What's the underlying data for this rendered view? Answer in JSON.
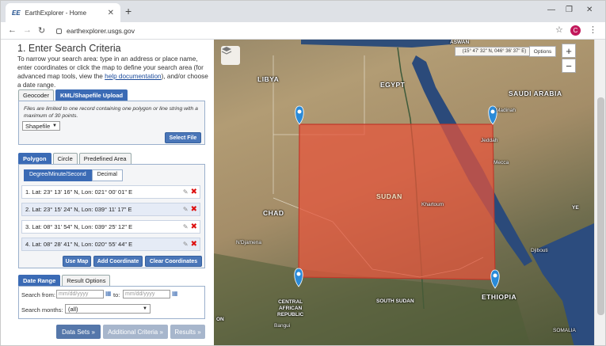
{
  "browser": {
    "tab_title": "EarthExplorer - Home",
    "tab_favicon": "EE",
    "url": "earthexplorer.usgs.gov",
    "avatar_letter": "C",
    "avatar_color": "#c2185b"
  },
  "panel": {
    "heading": "1. Enter Search Criteria",
    "intro_before_link": "To narrow your search area: type in an address or place name, enter coordinates or click the map to define your search area (for advanced map tools, view the ",
    "intro_link": "help documentation",
    "intro_after_link": "), and/or choose a date range.",
    "upload_tabs": [
      {
        "label": "Geocoder",
        "active": false
      },
      {
        "label": "KML/Shapefile Upload",
        "active": true
      }
    ],
    "upload_note": "Files are limited to one record containing one polygon or line string with a maximum of 30 points.",
    "file_type": "Shapefile",
    "select_file_label": "Select File",
    "shape_tabs": [
      {
        "label": "Polygon",
        "active": true
      },
      {
        "label": "Circle",
        "active": false
      },
      {
        "label": "Predefined Area",
        "active": false
      }
    ],
    "format_tabs": [
      {
        "label": "Degree/Minute/Second",
        "active": true
      },
      {
        "label": "Decimal",
        "active": false
      }
    ],
    "coordinates": [
      "1.  Lat: 23° 13' 16\" N, Lon: 021° 00' 01\" E",
      "2.  Lat: 23° 15' 24\" N, Lon: 039° 11' 17\" E",
      "3.  Lat: 08° 31' 54\" N, Lon: 039° 25' 12\" E",
      "4.  Lat: 08° 28' 41\" N, Lon: 020° 55' 44\" E"
    ],
    "use_map_label": "Use Map",
    "add_coordinate_label": "Add Coordinate",
    "clear_coordinates_label": "Clear Coordinates",
    "date_tabs": [
      {
        "label": "Date Range",
        "active": true
      },
      {
        "label": "Result Options",
        "active": false
      }
    ],
    "search_from_label": "Search from:",
    "date_placeholder": "mm/dd/yyyy",
    "to_label": "to:",
    "search_months_label": "Search months:",
    "months_value": "(all)",
    "bottom_buttons": [
      "Data Sets »",
      "Additional Criteria »",
      "Results »"
    ]
  },
  "map": {
    "cursor_coords": "(15° 47' 32\" N, 046° 36' 37\" E)",
    "options_label": "Options",
    "zoom_in": "+",
    "zoom_out": "−",
    "labels": {
      "libya": "LIBYA",
      "egypt": "EGYPT",
      "saudi": "SAUDI ARABIA",
      "sudan": "SUDAN",
      "chad": "CHAD",
      "car": "CENTRAL\nAFRICAN\nREPUBLIC",
      "south_sudan": "SOUTH SUDAN",
      "ethiopia": "ETHIOPIA",
      "somalia": "SOMALIA",
      "yemen": "YE",
      "on": "ON",
      "khartoum": "Khartoum",
      "jeddah": "Jeddah",
      "madinah": "Madinah",
      "djibouti": "Djibouti",
      "ndjamena": "N'Djamena",
      "mecca": "Mecca",
      "bangui": "Bangui",
      "aswan": "ASWAN"
    },
    "aoi_fill": "#e8543c"
  }
}
